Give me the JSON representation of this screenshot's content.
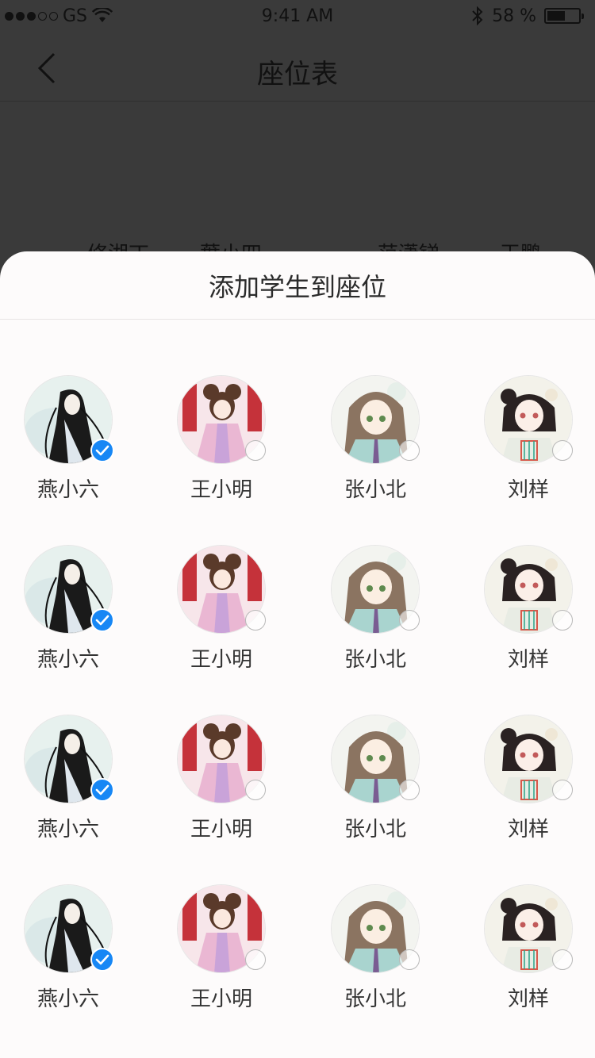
{
  "status_bar": {
    "carrier": "GS",
    "time": "9:41 AM",
    "battery_percent": "58 %",
    "battery_level": 0.58
  },
  "nav": {
    "title": "座位表"
  },
  "background_names": [
    "修湘丁",
    "葉小四",
    "范潇锑",
    "王鹏"
  ],
  "sheet": {
    "title": "添加学生到座位",
    "rows": [
      [
        {
          "name": "燕小六",
          "checked": true,
          "avatar": "avatar-long-black-hair"
        },
        {
          "name": "王小明",
          "checked": false,
          "avatar": "avatar-pink-hanfu"
        },
        {
          "name": "张小北",
          "checked": false,
          "avatar": "avatar-brown-hair"
        },
        {
          "name": "刘样",
          "checked": false,
          "avatar": "avatar-short-black-hair"
        }
      ],
      [
        {
          "name": "燕小六",
          "checked": true,
          "avatar": "avatar-long-black-hair"
        },
        {
          "name": "王小明",
          "checked": false,
          "avatar": "avatar-pink-hanfu"
        },
        {
          "name": "张小北",
          "checked": false,
          "avatar": "avatar-brown-hair"
        },
        {
          "name": "刘样",
          "checked": false,
          "avatar": "avatar-short-black-hair"
        }
      ],
      [
        {
          "name": "燕小六",
          "checked": true,
          "avatar": "avatar-long-black-hair"
        },
        {
          "name": "王小明",
          "checked": false,
          "avatar": "avatar-pink-hanfu"
        },
        {
          "name": "张小北",
          "checked": false,
          "avatar": "avatar-brown-hair"
        },
        {
          "name": "刘样",
          "checked": false,
          "avatar": "avatar-short-black-hair"
        }
      ],
      [
        {
          "name": "燕小六",
          "checked": true,
          "avatar": "avatar-long-black-hair"
        },
        {
          "name": "王小明",
          "checked": false,
          "avatar": "avatar-pink-hanfu"
        },
        {
          "name": "张小北",
          "checked": false,
          "avatar": "avatar-brown-hair"
        },
        {
          "name": "刘样",
          "checked": false,
          "avatar": "avatar-short-black-hair"
        }
      ]
    ]
  },
  "colors": {
    "accent": "#1787f5",
    "overlay": "#3a3a3a",
    "sheet_bg": "#fdfbfb"
  }
}
